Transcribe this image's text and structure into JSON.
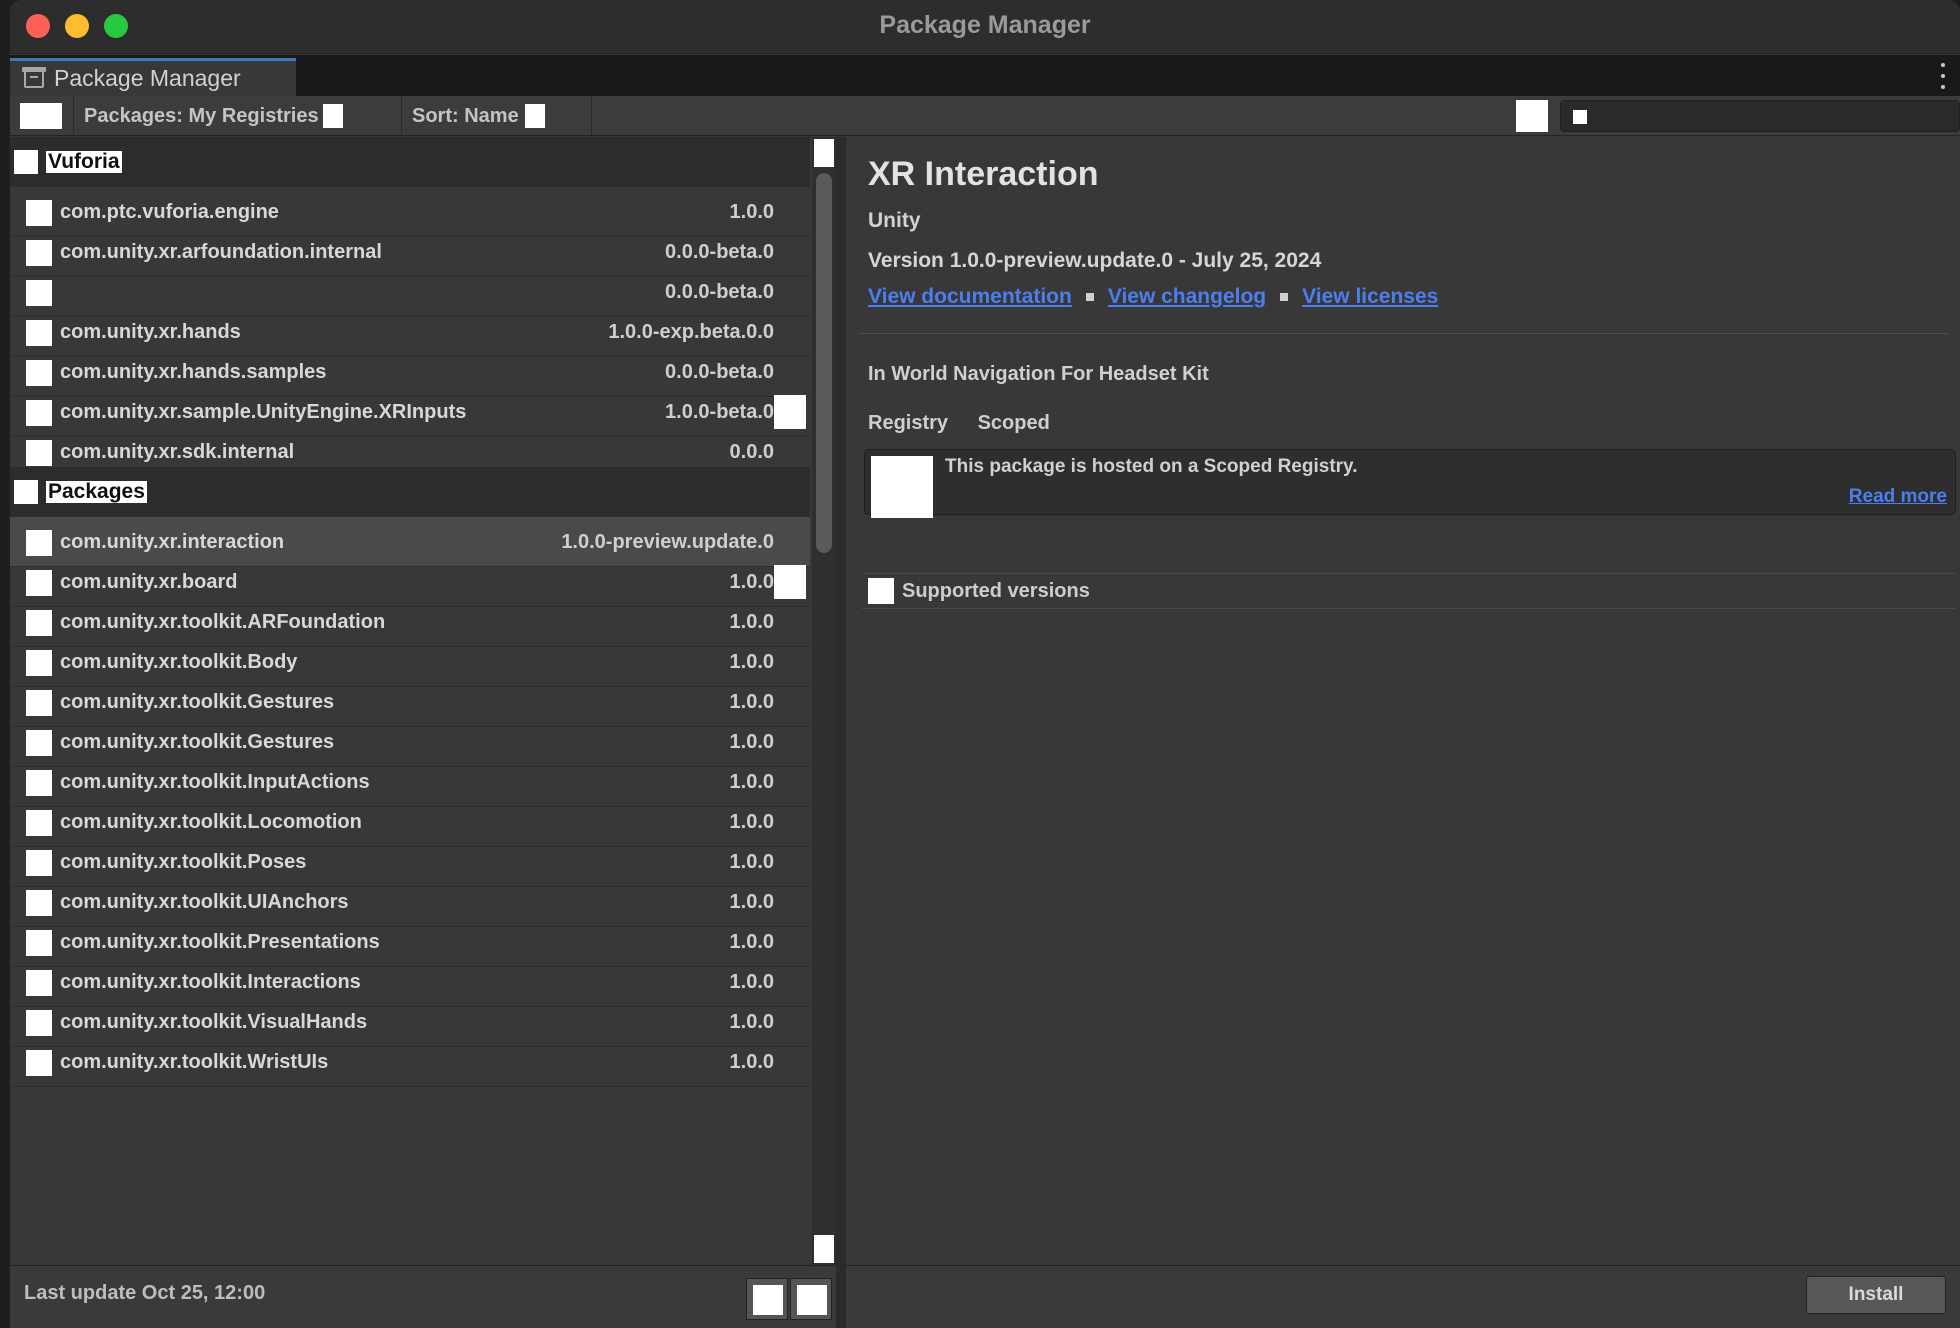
{
  "window": {
    "title": "Package Manager"
  },
  "tab": {
    "label": "Package Manager",
    "icon": "package-icon"
  },
  "toolbar": {
    "registry_label": "Packages: My Registries",
    "sort_label": "Sort: Name"
  },
  "list": {
    "sections": [
      {
        "label": "Vuforia",
        "items": [
          {
            "name": "com.ptc.vuforia.engine",
            "version": "1.0.0",
            "badge": false
          },
          {
            "name": "com.unity.xr.arfoundation.internal",
            "version": "0.0.0-beta.0",
            "badge": false
          },
          {
            "name": "",
            "version": "0.0.0-beta.0",
            "badge": false
          },
          {
            "name": "com.unity.xr.hands",
            "version": "1.0.0-exp.beta.0.0",
            "badge": false
          },
          {
            "name": "com.unity.xr.hands.samples",
            "version": "0.0.0-beta.0",
            "badge": false
          },
          {
            "name": "com.unity.xr.sample.UnityEngine.XRInputs",
            "version": "1.0.0-beta.0",
            "badge": true
          },
          {
            "name": "com.unity.xr.sdk.internal",
            "version": "0.0.0",
            "badge": false
          }
        ]
      },
      {
        "label": "Packages",
        "items": [
          {
            "name": "com.unity.xr.interaction",
            "version": "1.0.0-preview.update.0",
            "badge": false,
            "selected": true
          },
          {
            "name": "com.unity.xr.board",
            "version": "1.0.0",
            "badge": true
          },
          {
            "name": "com.unity.xr.toolkit.ARFoundation",
            "version": "1.0.0",
            "badge": false
          },
          {
            "name": "com.unity.xr.toolkit.Body",
            "version": "1.0.0",
            "badge": false
          },
          {
            "name": "com.unity.xr.toolkit.Gestures",
            "version": "1.0.0",
            "badge": false
          },
          {
            "name": "com.unity.xr.toolkit.Gestures",
            "version": "1.0.0",
            "badge": false
          },
          {
            "name": "com.unity.xr.toolkit.InputActions",
            "version": "1.0.0",
            "badge": false
          },
          {
            "name": "com.unity.xr.toolkit.Locomotion",
            "version": "1.0.0",
            "badge": false
          },
          {
            "name": "com.unity.xr.toolkit.Poses",
            "version": "1.0.0",
            "badge": false
          },
          {
            "name": "com.unity.xr.toolkit.UIAnchors",
            "version": "1.0.0",
            "badge": false
          },
          {
            "name": "com.unity.xr.toolkit.Presentations",
            "version": "1.0.0",
            "badge": false
          },
          {
            "name": "com.unity.xr.toolkit.Interactions",
            "version": "1.0.0",
            "badge": false
          },
          {
            "name": "com.unity.xr.toolkit.VisualHands",
            "version": "1.0.0",
            "badge": false
          },
          {
            "name": "com.unity.xr.toolkit.WristUIs",
            "version": "1.0.0",
            "badge": false
          }
        ]
      }
    ],
    "footer": {
      "last_update": "Last update Oct 25, 12:00"
    }
  },
  "detail": {
    "title": "XR Interaction",
    "subtitle": "Unity",
    "version_line": "Version 1.0.0-preview.update.0 - July 25, 2024",
    "links": [
      "View documentation",
      "View changelog",
      "View licenses"
    ],
    "description": "In World Navigation For Headset Kit",
    "registry_label": "Registry",
    "registry_value": "Scoped",
    "notice": {
      "text": "This package is hosted on a Scoped Registry.",
      "link": "Read more"
    },
    "samples_label": "Supported versions",
    "install_label": "Install"
  }
}
